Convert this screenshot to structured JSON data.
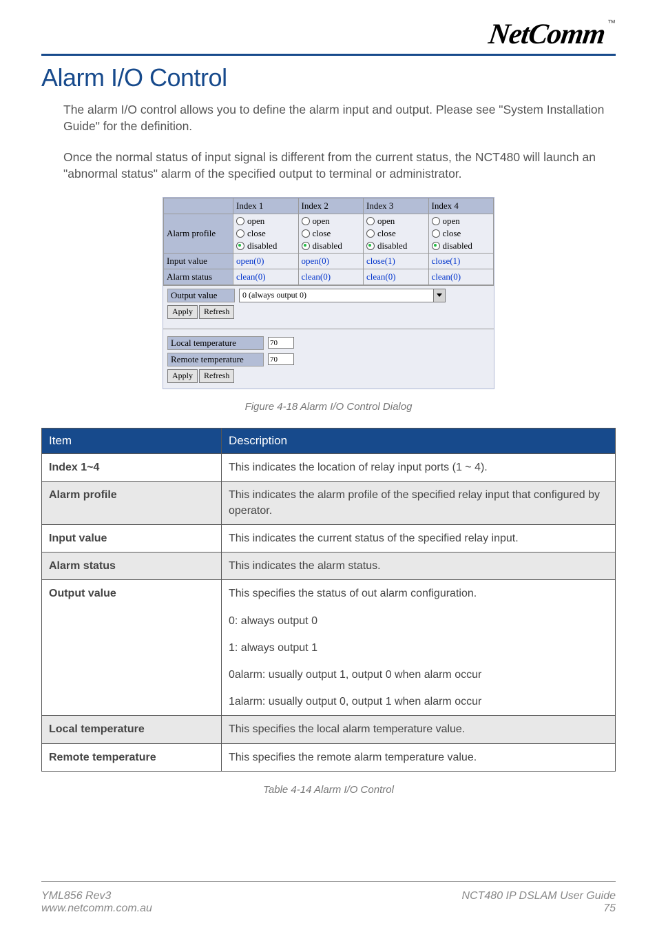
{
  "logo": {
    "text": "NetComm",
    "tm": "™"
  },
  "section_title": "Alarm I/O Control",
  "intro_p1": "The alarm I/O control allows you to define the alarm input and output. Please see \"System Installation Guide\" for the definition.",
  "intro_p2": "Once the normal status of input signal is different from the current status, the NCT480 will launch an \"abnormal status\" alarm of the specified output to terminal or administrator.",
  "dialog": {
    "index_headers": [
      "Index 1",
      "Index 2",
      "Index 3",
      "Index 4"
    ],
    "row_labels": {
      "alarm_profile": "Alarm profile",
      "input_value": "Input value",
      "alarm_status": "Alarm status",
      "output_value": "Output value"
    },
    "profile_options": {
      "open": "open",
      "close": "close",
      "disabled": "disabled"
    },
    "profile_selected": [
      "disabled",
      "disabled",
      "disabled",
      "disabled"
    ],
    "input_values": [
      "open(0)",
      "open(0)",
      "close(1)",
      "close(1)"
    ],
    "alarm_status_values": [
      "clean(0)",
      "clean(0)",
      "clean(0)",
      "clean(0)"
    ],
    "output_value_selected": "0 (always output 0)",
    "buttons": {
      "apply": "Apply",
      "refresh": "Refresh"
    },
    "local_temp": {
      "label": "Local temperature",
      "value": "70"
    },
    "remote_temp": {
      "label": "Remote temperature",
      "value": "70"
    }
  },
  "figure_caption": "Figure 4-18 Alarm I/O Control Dialog",
  "desc_table": {
    "head_item": "Item",
    "head_desc": "Description",
    "rows": [
      {
        "item": "Index 1~4",
        "desc": "This indicates the location of relay input ports (1 ~ 4).",
        "alt": false
      },
      {
        "item": "Alarm profile",
        "desc": "This indicates the alarm profile of the specified relay input that configured by operator.",
        "alt": true
      },
      {
        "item": "Input value",
        "desc": "This indicates the current status of the specified relay input.",
        "alt": false
      },
      {
        "item": "Alarm status",
        "desc": "This indicates the alarm status.",
        "alt": true
      },
      {
        "item": "Output value",
        "desc_multi": [
          "This specifies the status of out alarm configuration.",
          "0: always output 0",
          "1: always output 1",
          "0alarm: usually output 1, output 0 when alarm occur",
          "1alarm: usually output 0, output 1 when alarm occur"
        ],
        "alt": false
      },
      {
        "item": "Local temperature",
        "desc": "This specifies the local alarm temperature value.",
        "alt": true
      },
      {
        "item": "Remote temperature",
        "desc": "This specifies the remote alarm temperature value.",
        "alt": false
      }
    ]
  },
  "table_caption": "Table 4-14 Alarm I/O Control",
  "footer": {
    "left_line1": "YML856 Rev3",
    "left_line2": "www.netcomm.com.au",
    "right_line1": "NCT480 IP DSLAM User Guide",
    "right_line2": "75"
  }
}
